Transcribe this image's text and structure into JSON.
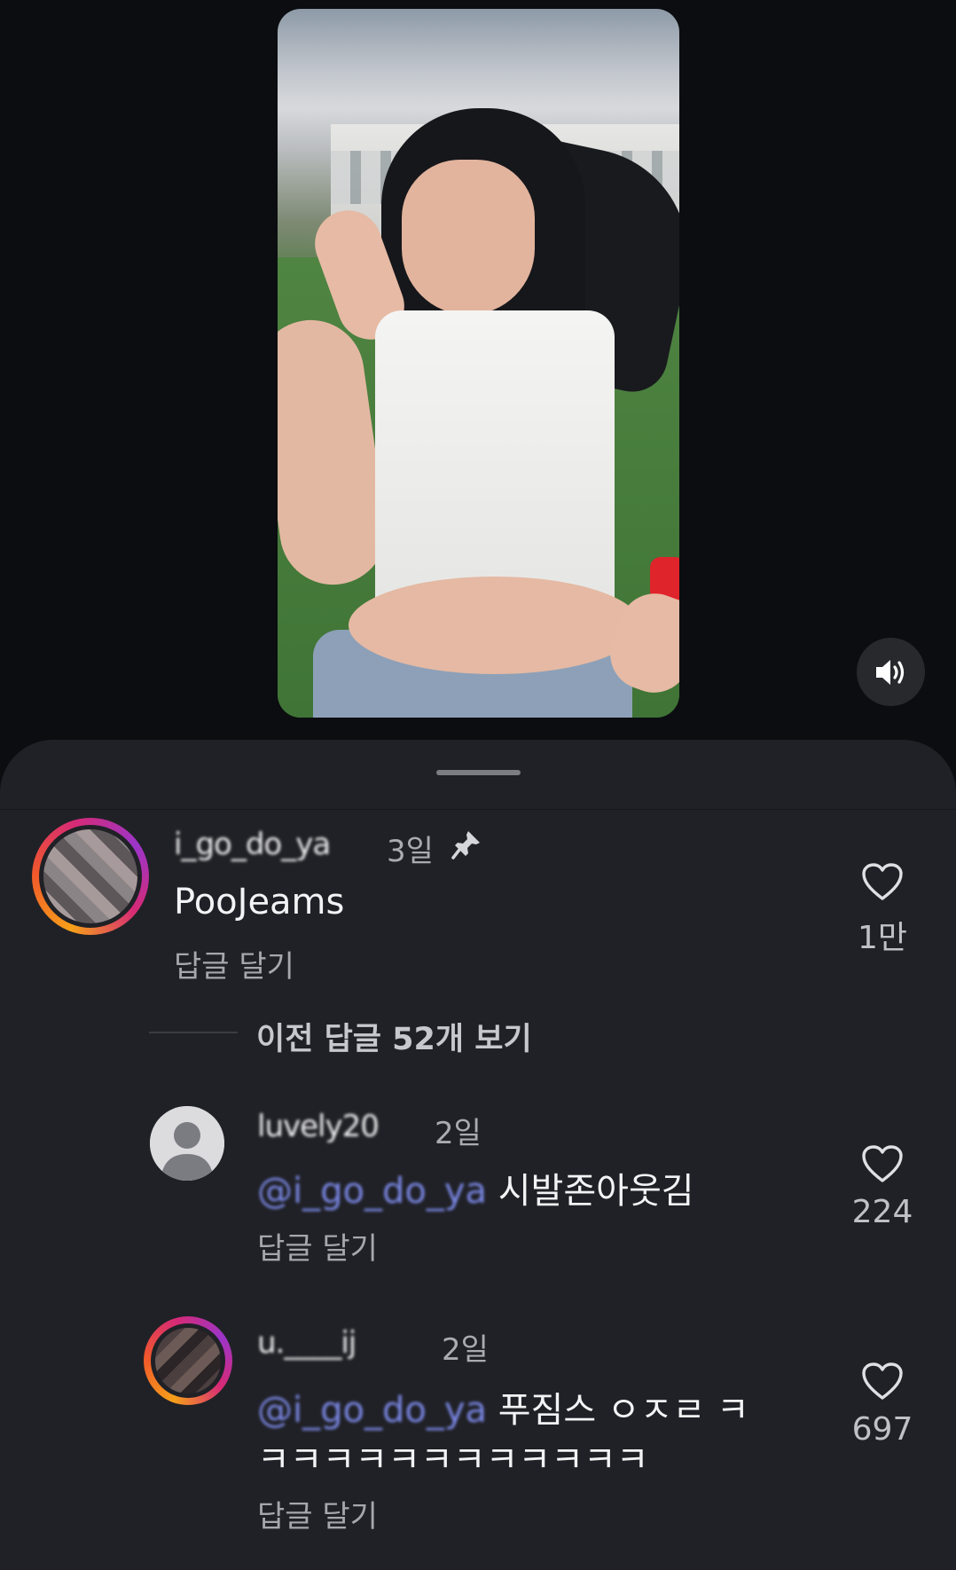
{
  "video": {
    "sound_icon": "speaker-icon"
  },
  "comments": [
    {
      "username": "i_go_do_ya",
      "time": "3일",
      "pinned": true,
      "text": "PooJeams",
      "reply_label": "답글 달기",
      "likes": "1만"
    }
  ],
  "view_replies_label": "이전 답글 52개 보기",
  "replies": [
    {
      "username": "luvely20",
      "time": "2일",
      "mention": "@i_go_do_ya",
      "text": "시발존아웃김",
      "reply_label": "답글 달기",
      "likes": "224"
    },
    {
      "username": "u.____ij",
      "time": "2일",
      "mention": "@i_go_do_ya",
      "text_line1": "푸짐스 ㅇㅈㄹ ㅋ",
      "text_line2": "ㅋㅋㅋㅋㅋㅋㅋㅋㅋㅋㅋㅋ",
      "reply_label": "답글 달기",
      "likes": "697"
    }
  ]
}
